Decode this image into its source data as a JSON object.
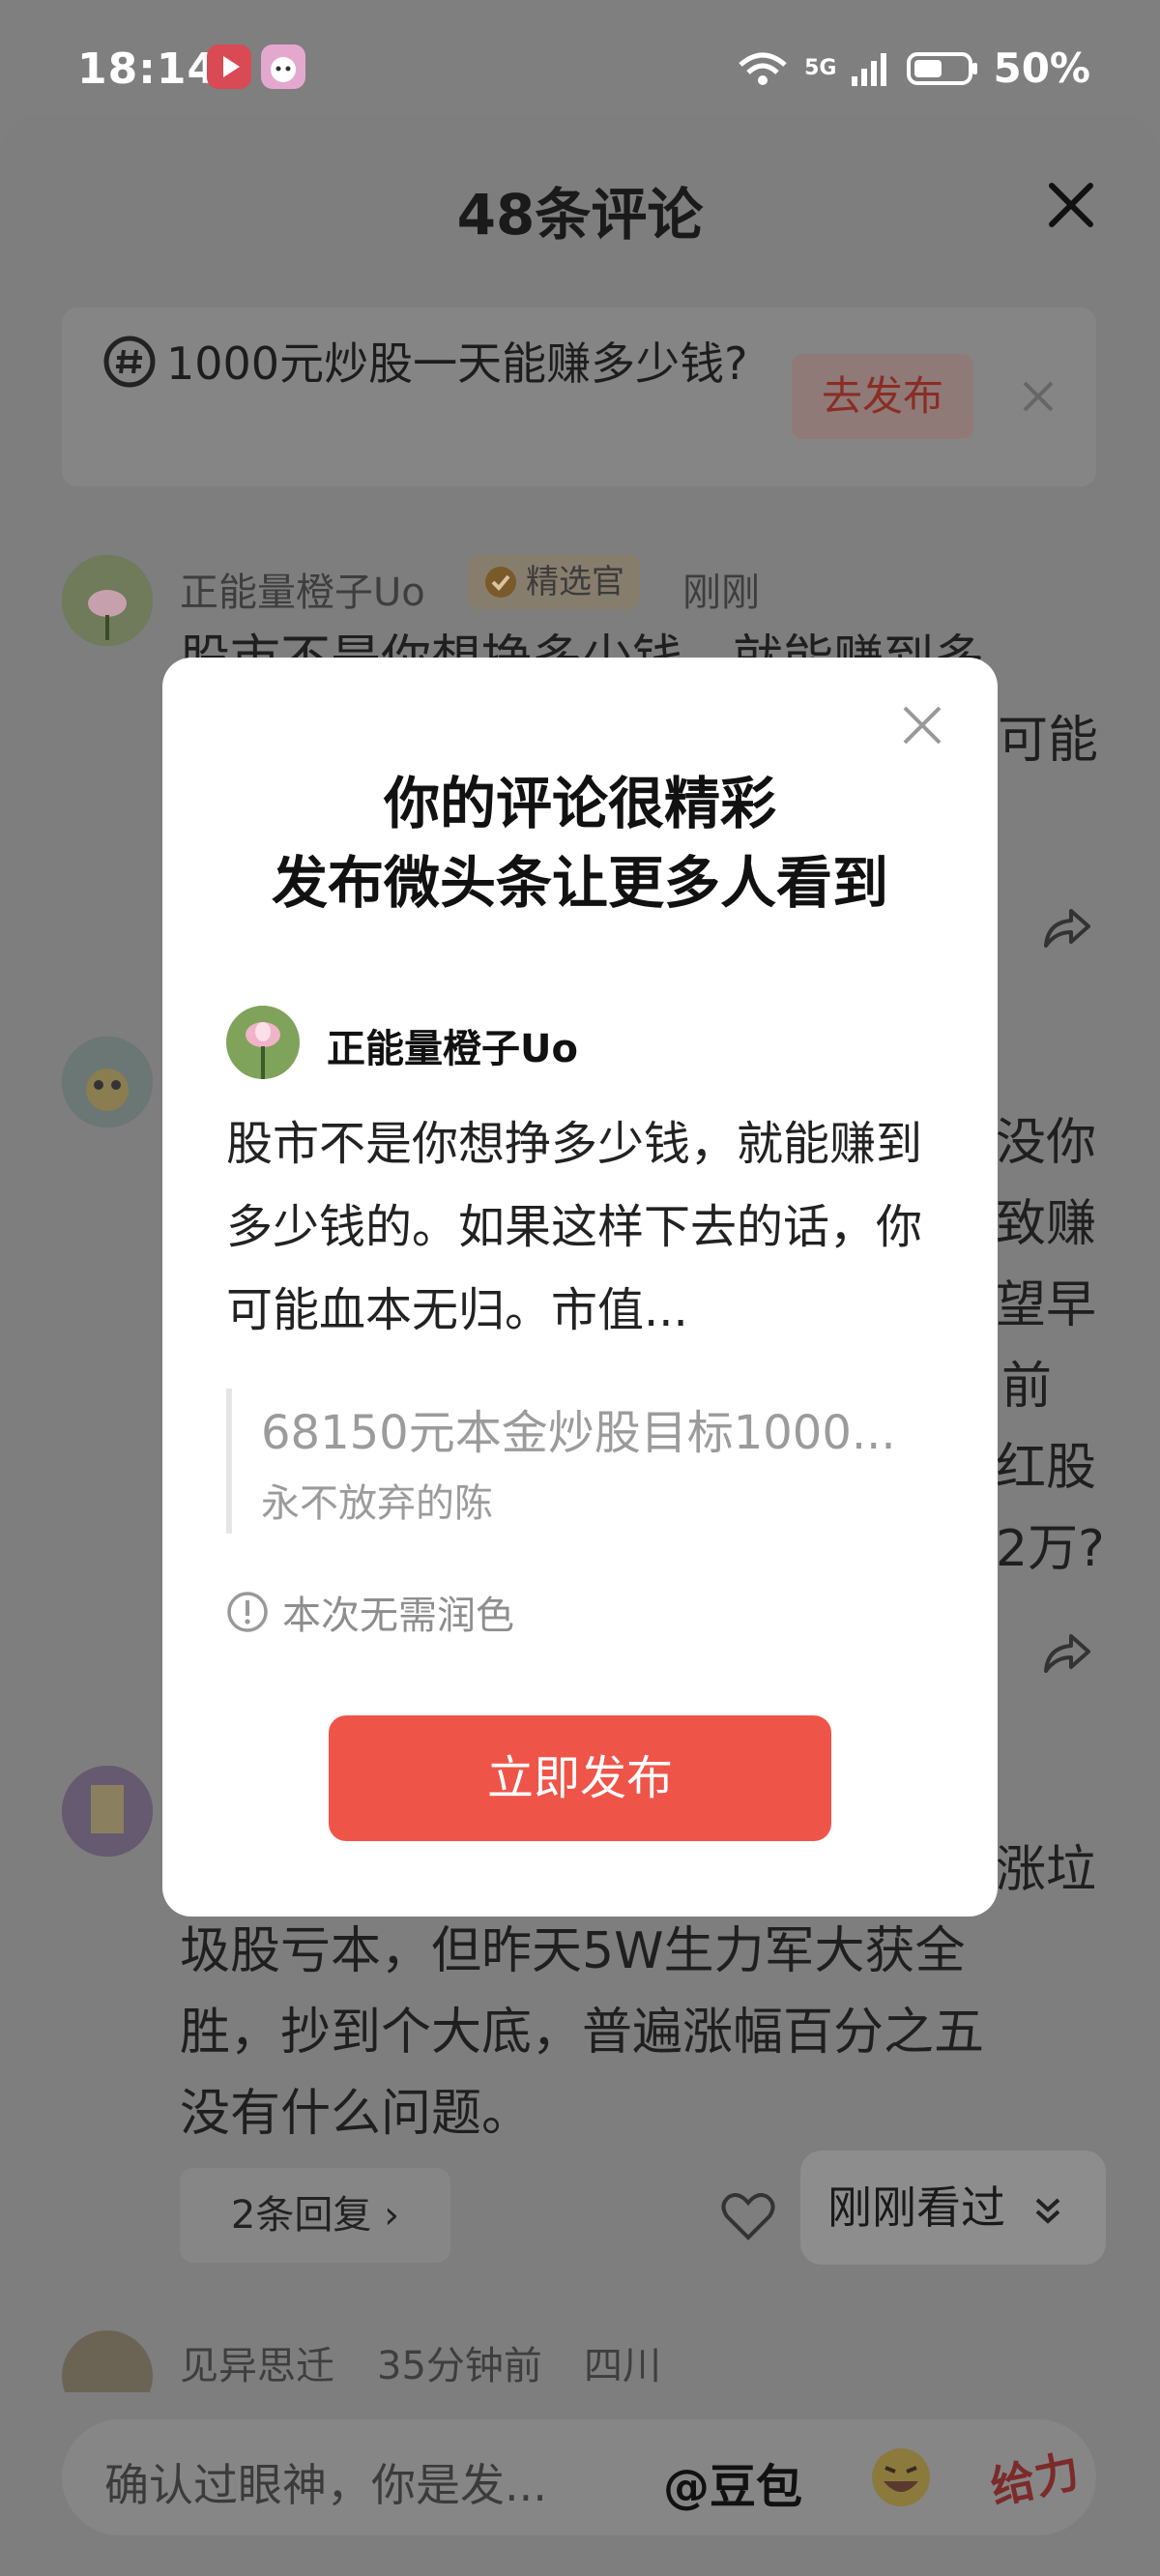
{
  "status_bar": {
    "time": "18:14",
    "battery": "50%",
    "network": "5G"
  },
  "sheet": {
    "title": "48条评论"
  },
  "topic": {
    "text": "1000元炒股一天能赚多少钱?",
    "button": "去发布"
  },
  "comments": [
    {
      "name": "正能量橙子Uo",
      "badge": "精选官",
      "time": "刚刚",
      "line1": "股市不是你想挣多少钱，就能赚到多",
      "line2_right": "可能"
    },
    {
      "right_lines": [
        "没你",
        "致赚",
        "望早",
        "前",
        "红股",
        "2万?"
      ]
    },
    {
      "line_right": "涨垃",
      "lines": [
        "圾股亏本，但昨天5W生力军大获全",
        "胜，抄到个大底，普遍涨幅百分之五",
        "没有什么问题。"
      ],
      "replies": "2条回复 ›"
    },
    {
      "name": "见异思迁",
      "time": "35分钟前",
      "location": "四川"
    }
  ],
  "recent_pill": "刚刚看过",
  "modal": {
    "title_line1": "你的评论很精彩",
    "title_line2": "发布微头条让更多人看到",
    "user": "正能量橙子Uo",
    "body": "股市不是你想挣多少钱，就能赚到多少钱的。如果这样下去的话，你可能血本无归。市值...",
    "quote_title": "68150元本金炒股目标1000...",
    "quote_author": "永不放弃的陈",
    "notice": "本次无需润色",
    "publish_button": "立即发布"
  },
  "input": {
    "placeholder": "确认过眼神，你是发...",
    "at": "@豆包",
    "give": "给力"
  }
}
